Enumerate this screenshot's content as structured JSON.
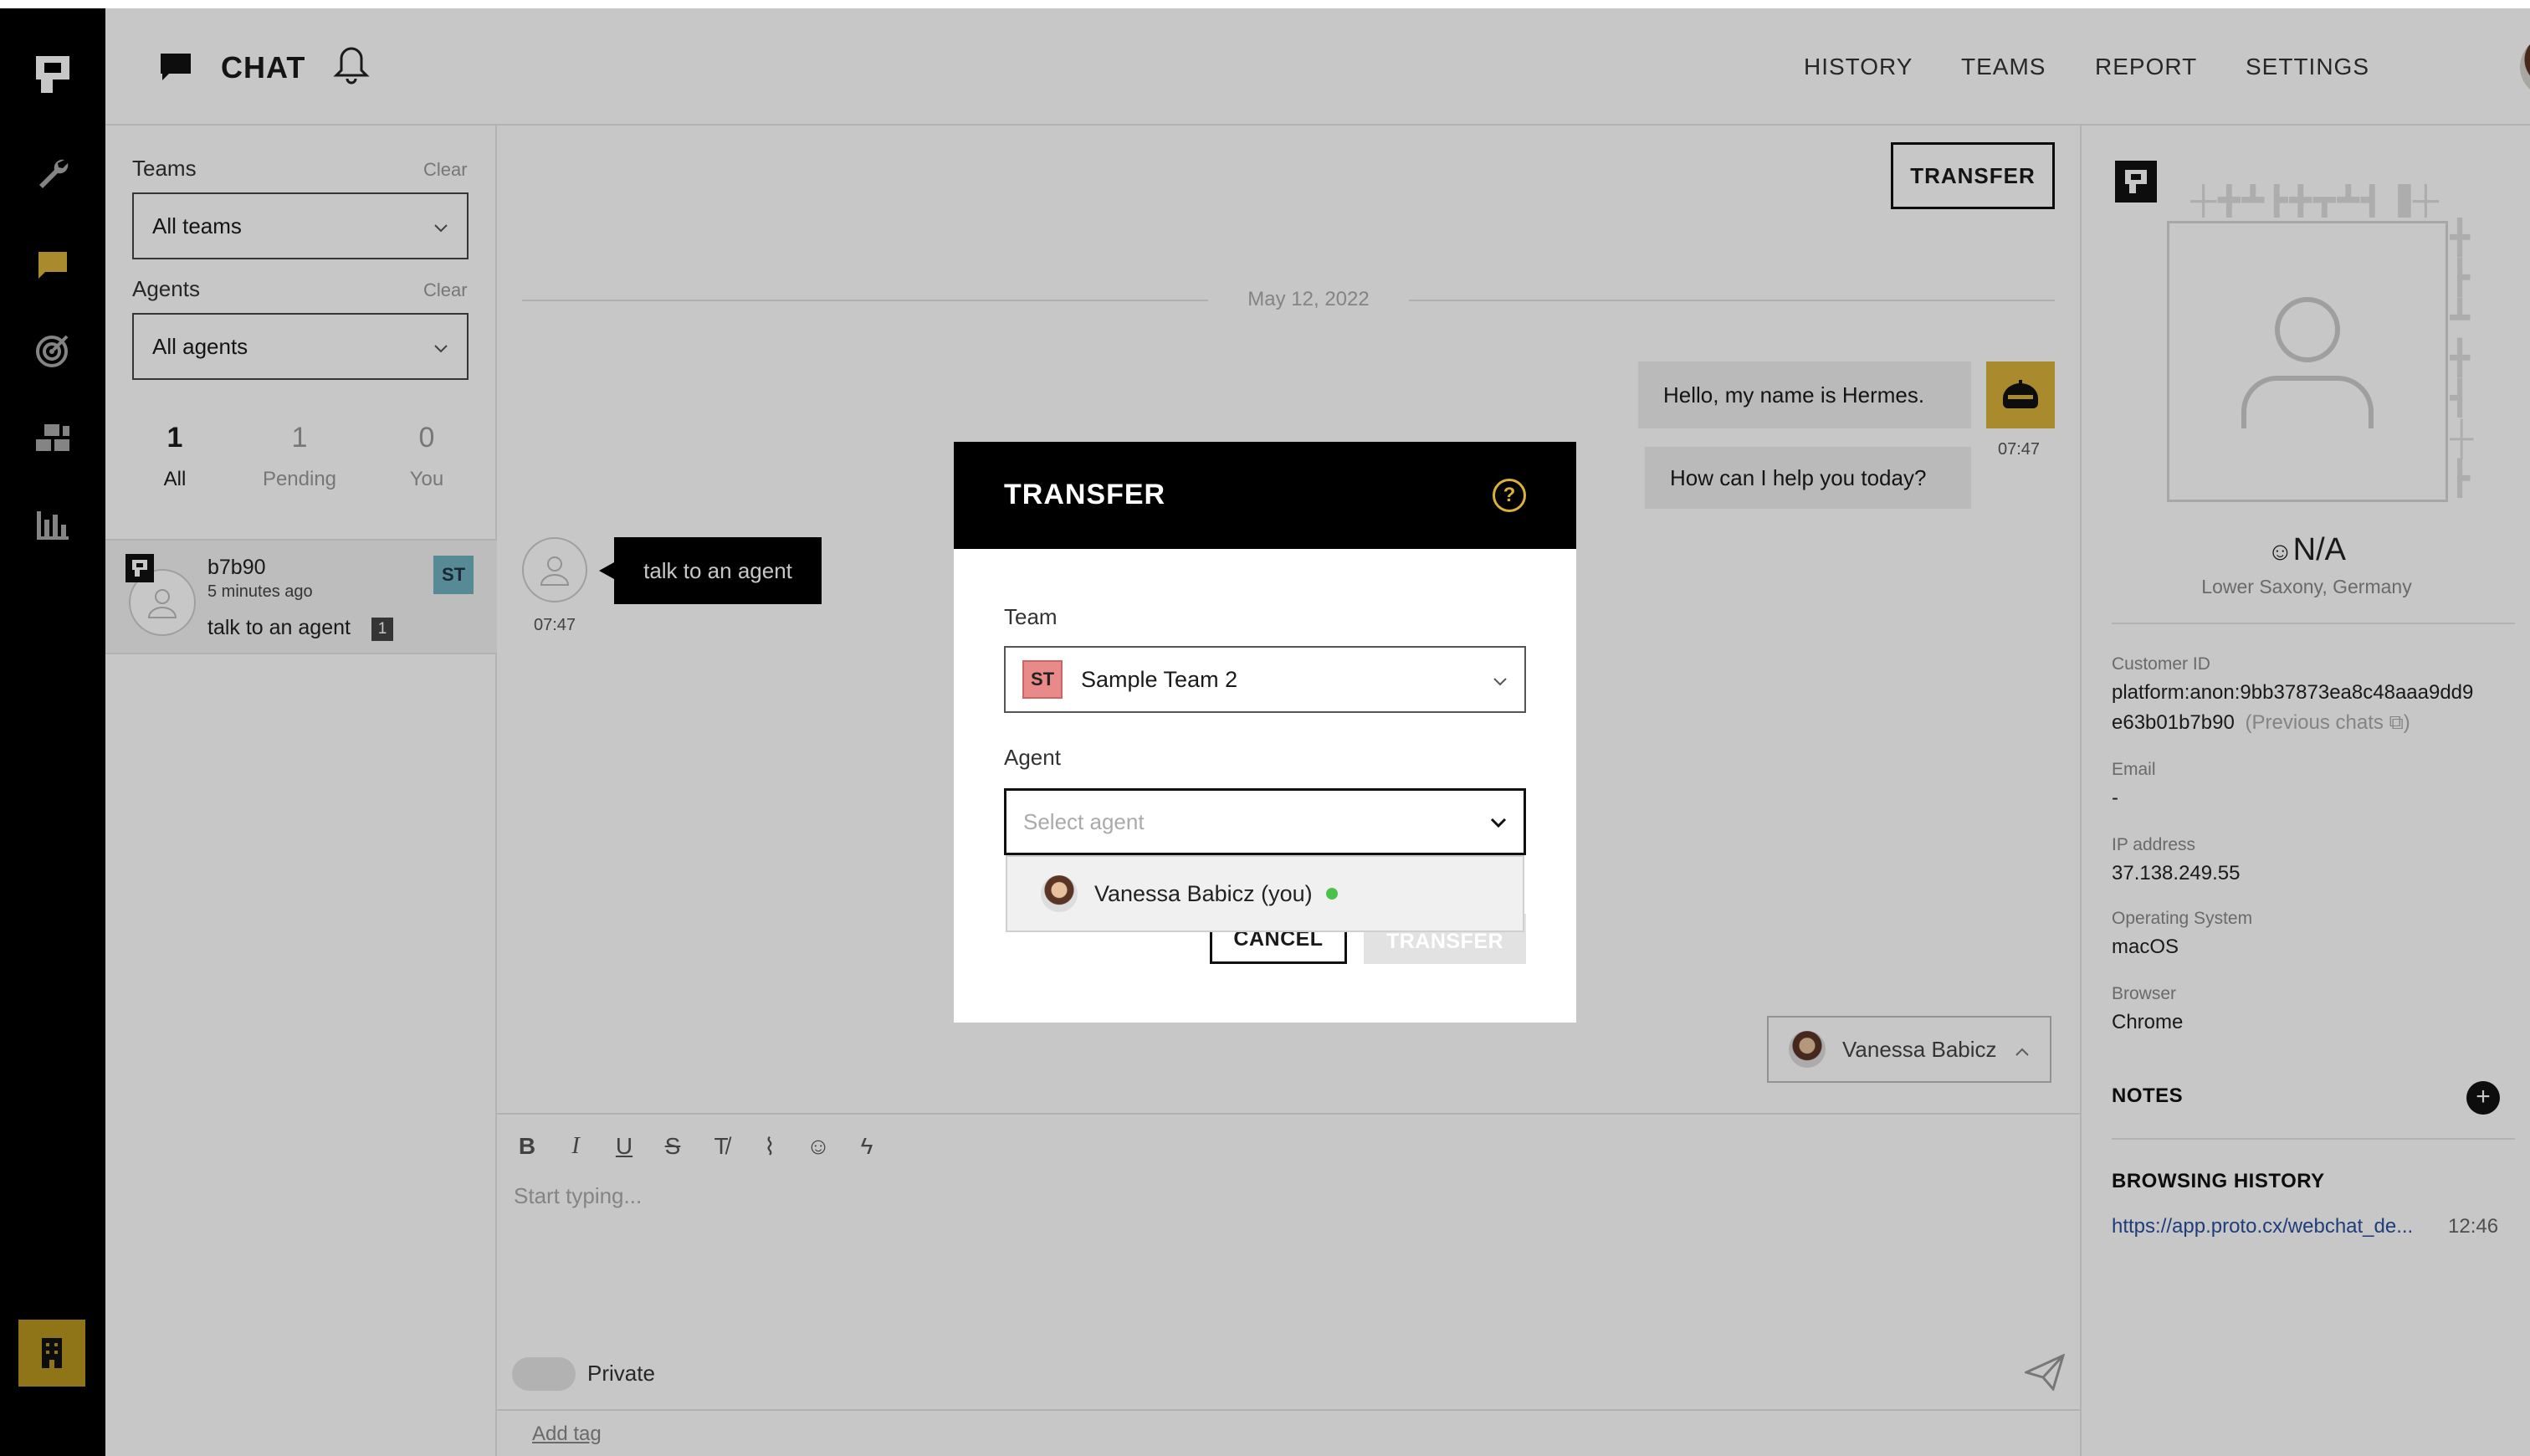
{
  "header": {
    "title": "CHAT",
    "nav": [
      "HISTORY",
      "TEAMS",
      "REPORT",
      "SETTINGS"
    ]
  },
  "filters": {
    "teams_label": "Teams",
    "teams_clear": "Clear",
    "teams_value": "All teams",
    "agents_label": "Agents",
    "agents_clear": "Clear",
    "agents_value": "All agents"
  },
  "counts": [
    {
      "num": "1",
      "label": "All"
    },
    {
      "num": "1",
      "label": "Pending"
    },
    {
      "num": "0",
      "label": "You"
    }
  ],
  "conversation": {
    "name": "b7b90",
    "time": "5 minutes ago",
    "preview": "talk to an agent",
    "badge": "1",
    "team_badge": "ST"
  },
  "chat": {
    "transfer_button": "TRANSFER",
    "date": "May 12, 2022",
    "bot_messages": [
      "Hello, my name is Hermes.",
      "How can I help you today?"
    ],
    "bot_time": "07:47",
    "user_message": "talk to an agent",
    "user_time": "07:47",
    "assignee": "Vanessa Babicz",
    "editor_placeholder": "Start typing...",
    "private_label": "Private",
    "add_tag": "Add tag"
  },
  "customer": {
    "name": "N/A",
    "location": "Lower Saxony, Germany",
    "customer_id_label": "Customer ID",
    "customer_id_line1": "platform:anon:9bb37873ea8c48aaa9dd9",
    "customer_id_line2": "e63b01b7b90",
    "previous_chats": "(Previous chats",
    "email_label": "Email",
    "email_value": "-",
    "ip_label": "IP address",
    "ip_value": "37.138.249.55",
    "os_label": "Operating System",
    "os_value": "macOS",
    "browser_label": "Browser",
    "browser_value": "Chrome",
    "notes_title": "NOTES",
    "browsing_title": "BROWSING HISTORY",
    "browsing_url": "https://app.proto.cx/webchat_de...",
    "browsing_time": "12:46"
  },
  "modal": {
    "title": "TRANSFER",
    "team_label": "Team",
    "team_badge": "ST",
    "team_value": "Sample Team 2",
    "agent_label": "Agent",
    "agent_placeholder": "Select agent",
    "cancel": "CANCEL",
    "transfer": "TRANSFER",
    "dropdown_option": "Vanessa Babicz (you)"
  },
  "colors": {
    "accent": "#d9b13a",
    "online": "#4cc14c",
    "team_badge": "#e88a8a",
    "link": "#2a4f9e"
  }
}
